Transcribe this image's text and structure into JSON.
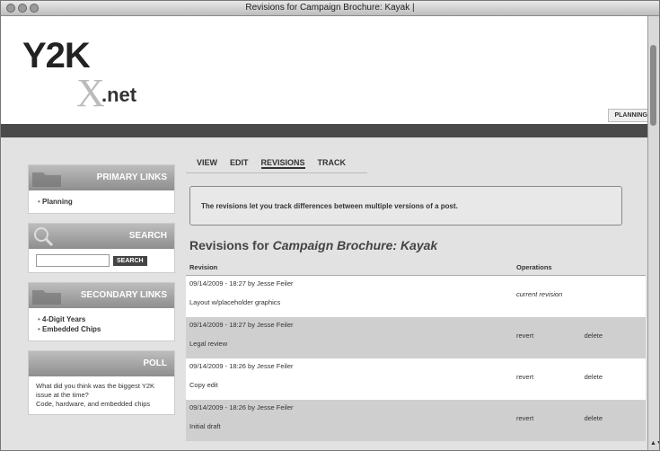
{
  "window": {
    "title": "Revisions for Campaign Brochure: Kayak |"
  },
  "logo": {
    "y2k": "Y2K",
    "x": "X",
    "net": ".net"
  },
  "header": {
    "planning_tab": "PLANNING"
  },
  "sidebar": {
    "primary": {
      "title": "PRIMARY LINKS",
      "items": [
        "Planning"
      ]
    },
    "search": {
      "title": "SEARCH",
      "button": "SEARCH"
    },
    "secondary": {
      "title": "SECONDARY LINKS",
      "items": [
        "4-Digit Years",
        "Embedded Chips"
      ]
    },
    "poll": {
      "title": "POLL",
      "question": "What did you think was the biggest Y2K issue at the time?",
      "option": "Code, hardware, and embedded chips"
    }
  },
  "tabs": [
    "VIEW",
    "EDIT",
    "REVISIONS",
    "TRACK"
  ],
  "notice": "The revisions let you track differences between multiple versions of a post.",
  "page_title": {
    "prefix": "Revisions for ",
    "node": "Campaign Brochure: Kayak"
  },
  "table": {
    "headers": [
      "Revision",
      "Operations"
    ],
    "rows": [
      {
        "meta": "09/14/2009 - 18:27 by Jesse Feiler",
        "log": "Layout w/placeholder graphics",
        "op1": "current revision",
        "op2": ""
      },
      {
        "meta": "09/14/2009 - 18:27 by Jesse Feiler",
        "log": "Legal review",
        "op1": "revert",
        "op2": "delete"
      },
      {
        "meta": "09/14/2009 - 18:26 by Jesse Feiler",
        "log": "Copy edit",
        "op1": "revert",
        "op2": "delete"
      },
      {
        "meta": "09/14/2009 - 18:26 by Jesse Feiler",
        "log": "Initial draft",
        "op1": "revert",
        "op2": "delete"
      }
    ]
  }
}
